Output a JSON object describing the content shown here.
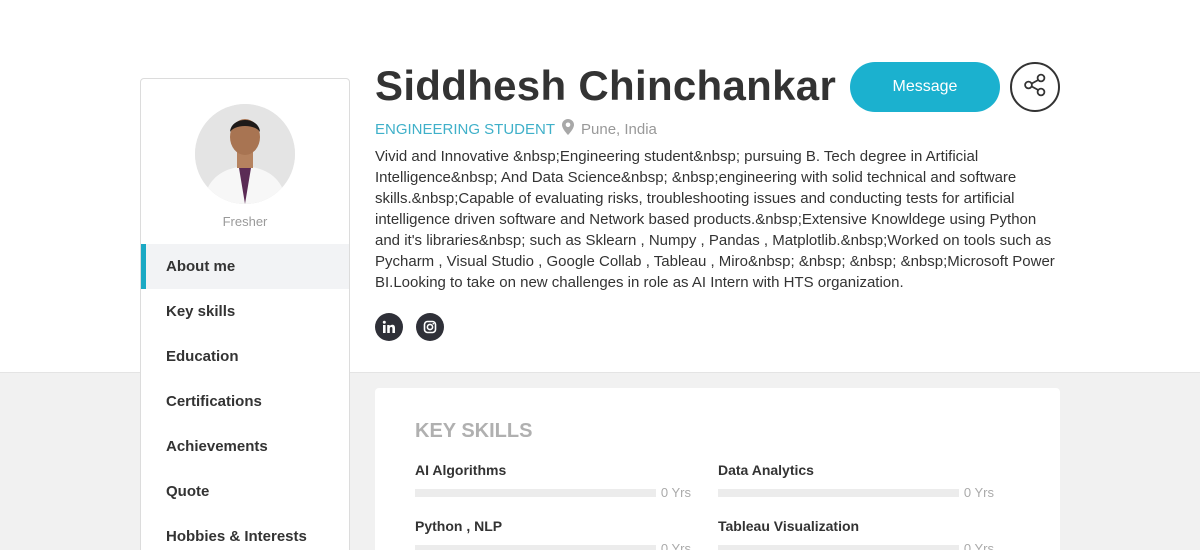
{
  "profile": {
    "name": "Siddhesh Chinchankar",
    "role": "ENGINEERING STUDENT",
    "location": "Pune, India",
    "status": "Fresher",
    "bio": "Vivid and Innovative &nbsp;Engineering student&nbsp; pursuing B. Tech degree in Artificial Intelligence&nbsp; And Data Science&nbsp; &nbsp;engineering with solid technical and software skills.&nbsp;Capable of evaluating risks, troubleshooting issues and conducting tests for artificial intelligence driven software and Network based products.&nbsp;Extensive Knowldege using Python and it's libraries&nbsp; such as Sklearn , Numpy , Pandas , Matplotlib.&nbsp;Worked on tools such as Pycharm , Visual Studio , Google Collab , Tableau , Miro&nbsp; &nbsp; &nbsp; &nbsp;Microsoft Power BI.Looking to take on new challenges in role as AI Intern with HTS organization."
  },
  "actions": {
    "message_label": "Message"
  },
  "social": [
    {
      "icon": "linkedin-icon"
    },
    {
      "icon": "instagram-icon"
    }
  ],
  "nav": {
    "items": [
      {
        "label": "About me",
        "active": true
      },
      {
        "label": "Key skills"
      },
      {
        "label": "Education"
      },
      {
        "label": "Certifications"
      },
      {
        "label": "Achievements"
      },
      {
        "label": "Quote"
      },
      {
        "label": "Hobbies & Interests"
      }
    ]
  },
  "skills": {
    "title": "KEY SKILLS",
    "items": [
      {
        "name": "AI Algorithms",
        "years": "0 Yrs",
        "level": 0
      },
      {
        "name": "Data Analytics",
        "years": "0 Yrs",
        "level": 0
      },
      {
        "name": "Python , NLP",
        "years": "0 Yrs",
        "level": 0
      },
      {
        "name": "Tableau Visualization",
        "years": "0 Yrs",
        "level": 0
      }
    ]
  },
  "colors": {
    "accent": "#1bb1cf",
    "role_text": "#3fb0c9",
    "dark": "#2f3038"
  }
}
